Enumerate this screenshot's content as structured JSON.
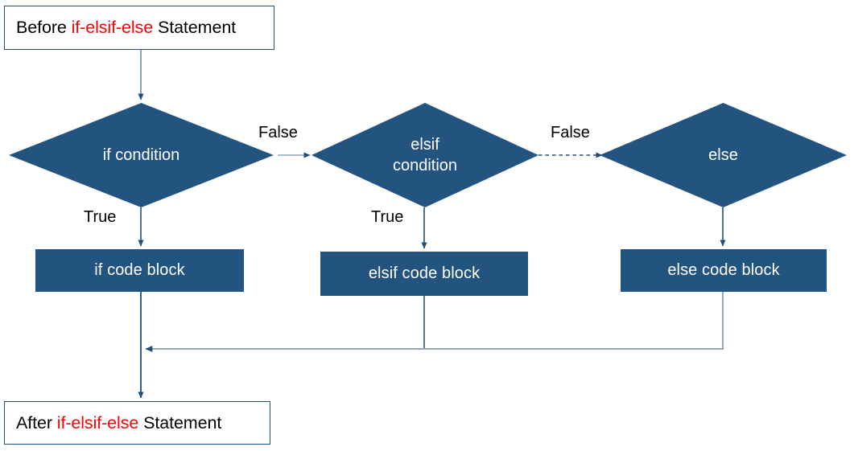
{
  "diagram": {
    "title": "if-elsif-else statement flowchart",
    "colors": {
      "shape_fill": "#235480",
      "shape_text": "#ffffff",
      "box_border": "#1F4E79",
      "box_text": "#000000",
      "keyword_highlight": "#FF0000",
      "connector_dark": "#1F4E79",
      "connector_light": "#8FA8C0",
      "background": "#ffffff"
    }
  },
  "nodes": {
    "start": {
      "type": "terminal",
      "text_before": "Before ",
      "keyword": "if-elsif-else",
      "text_after": " Statement"
    },
    "end": {
      "type": "terminal",
      "text_before": "After ",
      "keyword": "if-elsif-else",
      "text_after": " Statement"
    },
    "if_condition": {
      "type": "decision",
      "label": "if  condition"
    },
    "elsif_condition": {
      "type": "decision",
      "label": "elsif\ncondition"
    },
    "else_node": {
      "type": "decision",
      "label": "else"
    },
    "if_block": {
      "type": "process",
      "label": "if code block"
    },
    "elsif_block": {
      "type": "process",
      "label": "elsif code block"
    },
    "else_block": {
      "type": "process",
      "label": "else code block"
    }
  },
  "edge_labels": {
    "if_false": "False",
    "if_true": "True",
    "elsif_false": "False",
    "elsif_true": "True"
  },
  "edges": [
    {
      "from": "start",
      "to": "if_condition",
      "label": "",
      "style": "solid"
    },
    {
      "from": "if_condition",
      "to": "elsif_condition",
      "label": "False",
      "style": "solid"
    },
    {
      "from": "if_condition",
      "to": "if_block",
      "label": "True",
      "style": "solid"
    },
    {
      "from": "elsif_condition",
      "to": "else_node",
      "label": "False",
      "style": "dashed"
    },
    {
      "from": "elsif_condition",
      "to": "elsif_block",
      "label": "True",
      "style": "solid"
    },
    {
      "from": "else_node",
      "to": "else_block",
      "label": "",
      "style": "solid"
    },
    {
      "from": "if_block",
      "to": "end",
      "label": "",
      "style": "solid"
    },
    {
      "from": "elsif_block",
      "to": "merge",
      "label": "",
      "style": "solid"
    },
    {
      "from": "else_block",
      "to": "merge",
      "label": "",
      "style": "solid"
    }
  ]
}
